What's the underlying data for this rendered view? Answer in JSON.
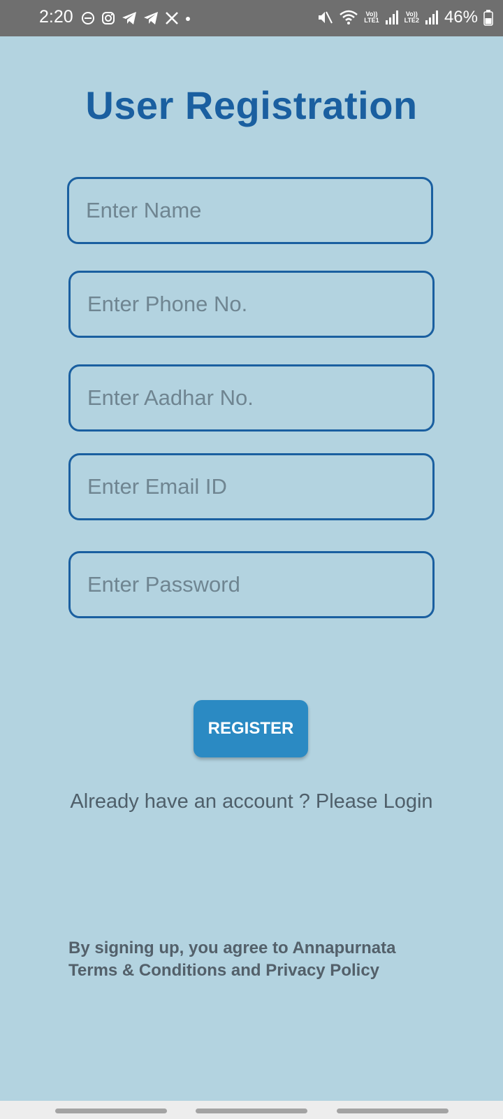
{
  "status_bar": {
    "time": "2:20",
    "battery_percent": "46%",
    "left_icons": [
      "do-not-disturb-icon",
      "instagram-icon",
      "telegram-icon",
      "telegram-icon",
      "x-icon",
      "dot-icon"
    ],
    "right_icons": [
      "mute-icon",
      "wifi-icon",
      "volte-lte1-icon",
      "signal-icon",
      "volte-lte2-icon",
      "signal-icon",
      "battery-icon"
    ],
    "lte1_top": "Vo))",
    "lte1_bottom": "LTE1",
    "lte2_top": "Vo))",
    "lte2_bottom": "LTE2"
  },
  "page": {
    "title": "User Registration"
  },
  "form": {
    "name_placeholder": "Enter Name",
    "phone_placeholder": "Enter Phone No.",
    "aadhar_placeholder": "Enter Aadhar No.",
    "email_placeholder": "Enter Email ID",
    "password_placeholder": "Enter Password",
    "register_label": "REGISTER",
    "login_prompt": "Already have an account ? Please Login"
  },
  "footer": {
    "terms_line1": "By signing up, you agree to Annapurnata",
    "terms_line2": "Terms & Conditions and Privacy Policy"
  },
  "colors": {
    "background": "#b3d3e0",
    "accent": "#1a5fa0",
    "button": "#2b8ac3",
    "status_bar": "#6f6f6f"
  }
}
